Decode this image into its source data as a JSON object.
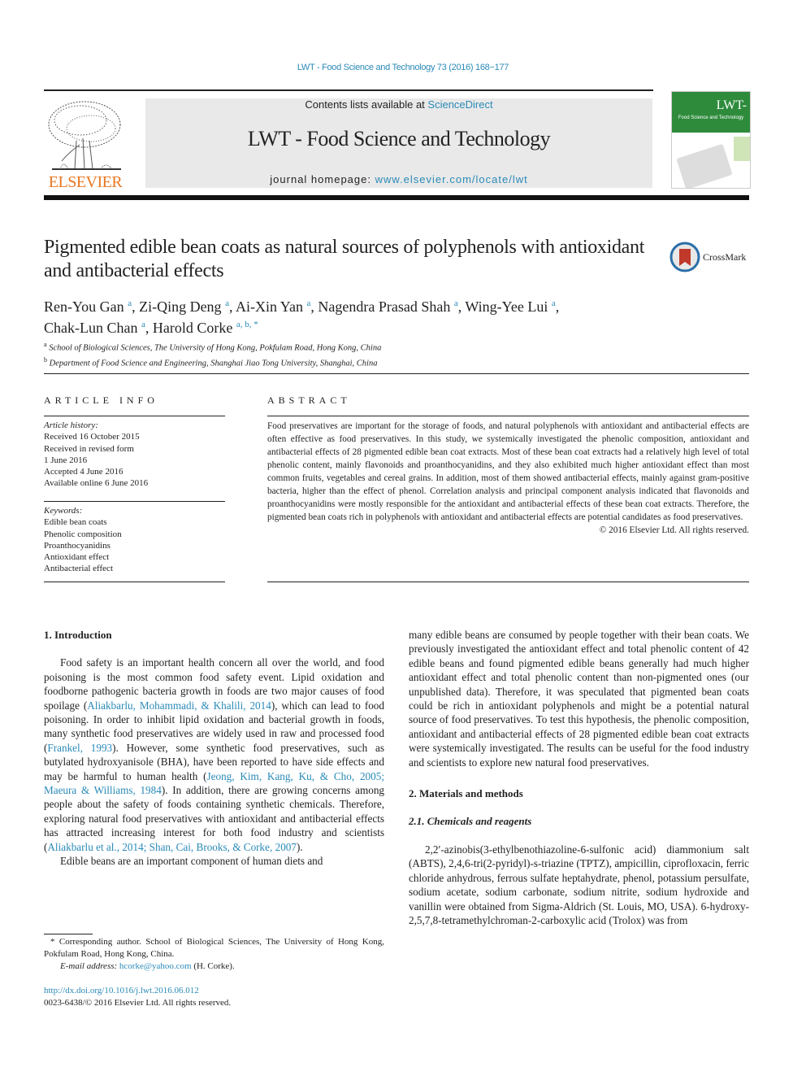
{
  "header": {
    "citation": "LWT - Food Science and Technology 73 (2016) 168−177",
    "contents_prefix": "Contents lists available at ",
    "contents_link": "ScienceDirect",
    "journal_title": "LWT - Food Science and Technology",
    "homepage_prefix": "journal homepage: ",
    "homepage_link": "www.elsevier.com/locate/lwt",
    "publisher_logo_text": "ELSEVIER",
    "cover": {
      "title": "LWT-",
      "subtitle": "Food Science and Technology",
      "color": "#2e8b3c"
    }
  },
  "article": {
    "title": "Pigmented edible bean coats as natural sources of polyphenols with antioxidant and antibacterial effects",
    "crossmark_label": "CrossMark",
    "authors": [
      {
        "name": "Ren-You Gan",
        "aff": "a"
      },
      {
        "name": "Zi-Qing Deng",
        "aff": "a"
      },
      {
        "name": "Ai-Xin Yan",
        "aff": "a"
      },
      {
        "name": "Nagendra Prasad Shah",
        "aff": "a"
      },
      {
        "name": "Wing-Yee Lui",
        "aff": "a"
      },
      {
        "name": "Chak-Lun Chan",
        "aff": "a"
      },
      {
        "name": "Harold Corke",
        "aff": "a, b, *"
      }
    ],
    "affiliations": [
      {
        "key": "a",
        "text": "School of Biological Sciences, The University of Hong Kong, Pokfulam Road, Hong Kong, China"
      },
      {
        "key": "b",
        "text": "Department of Food Science and Engineering, Shanghai Jiao Tong University, Shanghai, China"
      }
    ]
  },
  "article_info": {
    "heading": "ARTICLE INFO",
    "history_label": "Article history:",
    "history": [
      "Received 16 October 2015",
      "Received in revised form",
      "1 June 2016",
      "Accepted 4 June 2016",
      "Available online 6 June 2016"
    ],
    "keywords_label": "Keywords:",
    "keywords": [
      "Edible bean coats",
      "Phenolic composition",
      "Proanthocyanidins",
      "Antioxidant effect",
      "Antibacterial effect"
    ]
  },
  "abstract": {
    "heading": "ABSTRACT",
    "text": "Food preservatives are important for the storage of foods, and natural polyphenols with antioxidant and antibacterial effects are often effective as food preservatives. In this study, we systemically investigated the phenolic composition, antioxidant and antibacterial effects of 28 pigmented edible bean coat extracts. Most of these bean coat extracts had a relatively high level of total phenolic content, mainly flavonoids and proanthocyanidins, and they also exhibited much higher antioxidant effect than most common fruits, vegetables and cereal grains. In addition, most of them showed antibacterial effects, mainly against gram-positive bacteria, higher than the effect of phenol. Correlation analysis and principal component analysis indicated that flavonoids and proanthocyanidins were mostly responsible for the antioxidant and antibacterial effects of these bean coat extracts. Therefore, the pigmented bean coats rich in polyphenols with antioxidant and antibacterial effects are potential candidates as food preservatives.",
    "copyright": "© 2016 Elsevier Ltd. All rights reserved."
  },
  "body": {
    "intro_heading": "1.  Introduction",
    "intro_p1": [
      {
        "t": "Food safety is an important health concern all over the world, and food poisoning is the most common food safety event. Lipid oxidation and foodborne pathogenic bacteria growth in foods are two major causes of food spoilage ("
      },
      {
        "l": "Aliakbarlu, Mohammadi, & Khalili, 2014"
      },
      {
        "t": "), which can lead to food poisoning. In order to inhibit lipid oxidation and bacterial growth in foods, many synthetic food preservatives are widely used in raw and processed food ("
      },
      {
        "l": "Frankel, 1993"
      },
      {
        "t": "). However, some synthetic food preservatives, such as butylated hydroxyanisole (BHA), have been reported to have side effects and may be harmful to human health ("
      },
      {
        "l": "Jeong, Kim, Kang, Ku, & Cho, 2005; Maeura & Williams, 1984"
      },
      {
        "t": "). In addition, there are growing concerns among people about the safety of foods containing synthetic chemicals. Therefore, exploring natural food preservatives with antioxidant and antibacterial effects has attracted increasing interest for both food industry and scientists ("
      },
      {
        "l": "Aliakbarlu et al., 2014; Shan, Cai, Brooks, & Corke, 2007"
      },
      {
        "t": ")."
      }
    ],
    "intro_p2_start": "Edible beans are an important component of human diets and",
    "intro_p2_cont": "many edible beans are consumed by people together with their bean coats. We previously investigated the antioxidant effect and total phenolic content of 42 edible beans and found pigmented edible beans generally had much higher antioxidant effect and total phenolic content than non-pigmented ones (our unpublished data). Therefore, it was speculated that pigmented bean coats could be rich in antioxidant polyphenols and might be a potential natural source of food preservatives. To test this hypothesis, the phenolic composition, antioxidant and antibacterial effects of 28 pigmented edible bean coat extracts were systemically investigated. The results can be useful for the food industry and scientists to explore new natural food preservatives.",
    "methods_heading": "2.  Materials and methods",
    "sub_heading": "2.1.  Chemicals and reagents",
    "methods_p1": "2,2′-azinobis(3-ethylbenothiazoline-6-sulfonic acid) diammonium salt (ABTS), 2,4,6-tri(2-pyridyl)-s-triazine (TPTZ), ampicillin, ciprofloxacin, ferric chloride anhydrous, ferrous sulfate heptahydrate, phenol, potassium persulfate, sodium acetate, sodium carbonate, sodium nitrite, sodium hydroxide and vanillin were obtained from Sigma-Aldrich (St. Louis, MO, USA). 6-hydroxy-2,5,7,8-tetramethylchroman-2-carboxylic acid (Trolox) was from"
  },
  "footnote": {
    "corresponding": "* Corresponding author. School of Biological Sciences, The University of Hong Kong, Pokfulam Road, Hong Kong, China.",
    "email_label": "E-mail address: ",
    "email": "hcorke@yahoo.com",
    "email_suffix": " (H. Corke).",
    "doi": "http://dx.doi.org/10.1016/j.lwt.2016.06.012",
    "issn": "0023-6438/© 2016 Elsevier Ltd. All rights reserved."
  }
}
